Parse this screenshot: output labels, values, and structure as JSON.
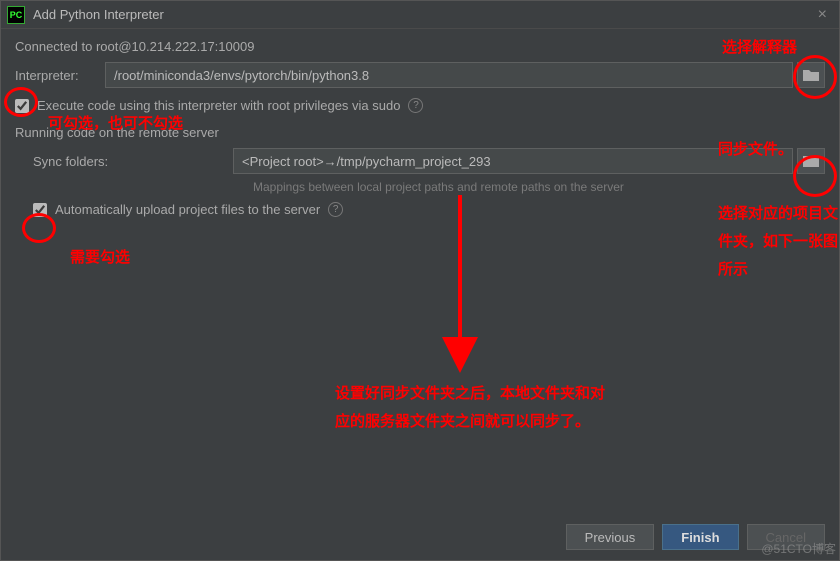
{
  "title": "Add Python Interpreter",
  "connected": "Connected to root@10.214.222.17:10009",
  "interpreter_label": "Interpreter:",
  "interpreter_path": "/root/miniconda3/envs/pytorch/bin/python3.8",
  "sudo_cb": "Execute code using this interpreter with root privileges via sudo",
  "section": "Running code on the remote server",
  "sync_label": "Sync folders:",
  "sync_value": "<Project root>→/tmp/pycharm_project_293",
  "sync_hint": "Mappings between local project paths and remote paths on the server",
  "auto_upload_cb": "Automatically upload project files to the server",
  "buttons": {
    "previous": "Previous",
    "finish": "Finish",
    "cancel": "Cancel"
  },
  "annotations": {
    "select_interpreter": "选择解释器",
    "sudo_note": "可勾选，也可不勾选",
    "need_check": "需要勾选",
    "sync_header": "同步文件。",
    "sync_side": "选择对应的项目文件夹，如下一张图所示",
    "main_note": "设置好同步文件夹之后，本地文件夹和对应的服务器文件夹之间就可以同步了。"
  },
  "watermark": "@51CTO博客"
}
